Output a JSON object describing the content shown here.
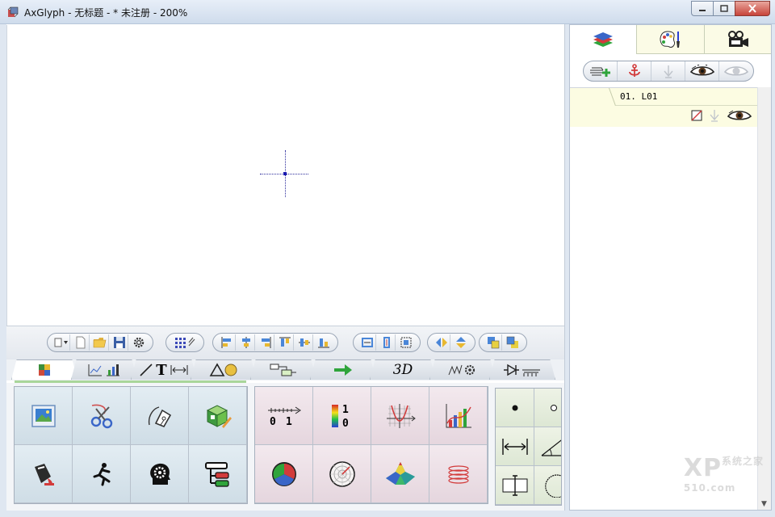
{
  "window": {
    "title": "AxGlyph - 无标题 - * 未注册 - 200%",
    "controls": [
      "minimize",
      "maximize",
      "close"
    ]
  },
  "toolbar": {
    "groups": [
      [
        "shape-menu-icon",
        "new-file-icon",
        "open-folder-icon",
        "save-disk-icon",
        "settings-gear-icon"
      ],
      [
        "grid-snap-icon"
      ],
      [
        "align-left-icon",
        "align-center-h-icon",
        "align-right-icon",
        "align-top-icon",
        "align-middle-v-icon",
        "align-bottom-icon"
      ],
      [
        "distribute-h-icon",
        "distribute-v-icon",
        "center-page-icon"
      ],
      [
        "flip-h-icon",
        "flip-v-icon"
      ],
      [
        "bring-front-icon",
        "send-back-icon"
      ]
    ]
  },
  "tabs": {
    "items": [
      "",
      "",
      "T",
      "",
      "",
      "",
      "3D",
      "",
      ""
    ],
    "tab3d": "3D",
    "tabT": "T",
    "active": 0
  },
  "palette": {
    "left_group": [
      "image-icon",
      "scissors-icon",
      "pen-nib-icon",
      "cube-pencil-icon",
      "paint-bucket-icon",
      "running-man-icon",
      "head-gear-icon",
      "tree-list-icon"
    ],
    "middle_group": [
      "ruler-icon",
      "color-bar-icon",
      "function-graph-icon",
      "chart-icon",
      "pie-chart-icon",
      "polar-plot-icon",
      "surface-3d-icon",
      "spiral-icon"
    ],
    "middle_labels": {
      "ruler_left": "0",
      "ruler_right": "1",
      "colorbar_top": "1",
      "colorbar_bottom": "0"
    },
    "right_group": [
      "point-filled-icon",
      "point-hollow-icon",
      "dimension-arrow-icon",
      "angle-icon",
      "text-cursor-box-icon",
      "arc-icon"
    ]
  },
  "layers_panel": {
    "tabs": [
      "layers-stack-icon",
      "palette-brush-icon",
      "video-camera-icon"
    ],
    "tools": [
      "add-layer-icon",
      "anchor-icon",
      "merge-down-icon",
      "eye-visible-icon",
      "eye-hidden-icon"
    ],
    "layers": [
      {
        "name": "01. L01",
        "visible": true
      }
    ]
  },
  "watermark": {
    "main": "XP",
    "sub": "系统之家",
    "domain": "510.com"
  },
  "colors": {
    "titlebar": "#cfdcec",
    "accent_green": "#a9d69a",
    "layer_highlight": "#fcfce2",
    "crosshair": "#2d2d9c",
    "close_button": "#c7443a"
  }
}
